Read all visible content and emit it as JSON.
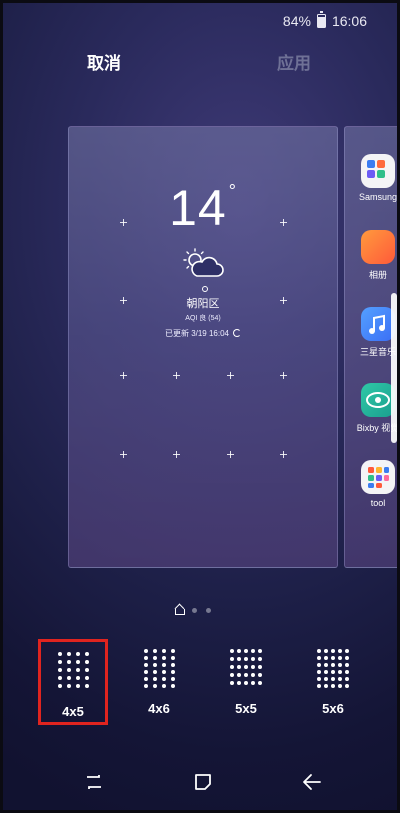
{
  "status_bar": {
    "battery": "84%",
    "time": "16:06"
  },
  "actions": {
    "cancel": "取消",
    "apply": "应用"
  },
  "weather_widget": {
    "temperature": "14",
    "degree": "°",
    "location": "朝阳区",
    "aqi": "AQI 良 (54)",
    "updated": "已更新 3/19 16:04"
  },
  "side_apps": [
    {
      "icon": "samsung-folder-icon",
      "label": "Samsung"
    },
    {
      "icon": "gallery-icon",
      "label": "相册"
    },
    {
      "icon": "music-icon",
      "label": "三星音乐"
    },
    {
      "icon": "bixby-vision-icon",
      "label": "Bixby 视觉"
    },
    {
      "icon": "tool-folder-icon",
      "label": "tool"
    }
  ],
  "grid_options": [
    {
      "label": "4x5",
      "selected": true
    },
    {
      "label": "4x6",
      "selected": false
    },
    {
      "label": "5x5",
      "selected": false
    },
    {
      "label": "5x6",
      "selected": false
    }
  ],
  "colors": {
    "selection": "#e0241f",
    "apply_disabled": "#6f7196"
  }
}
